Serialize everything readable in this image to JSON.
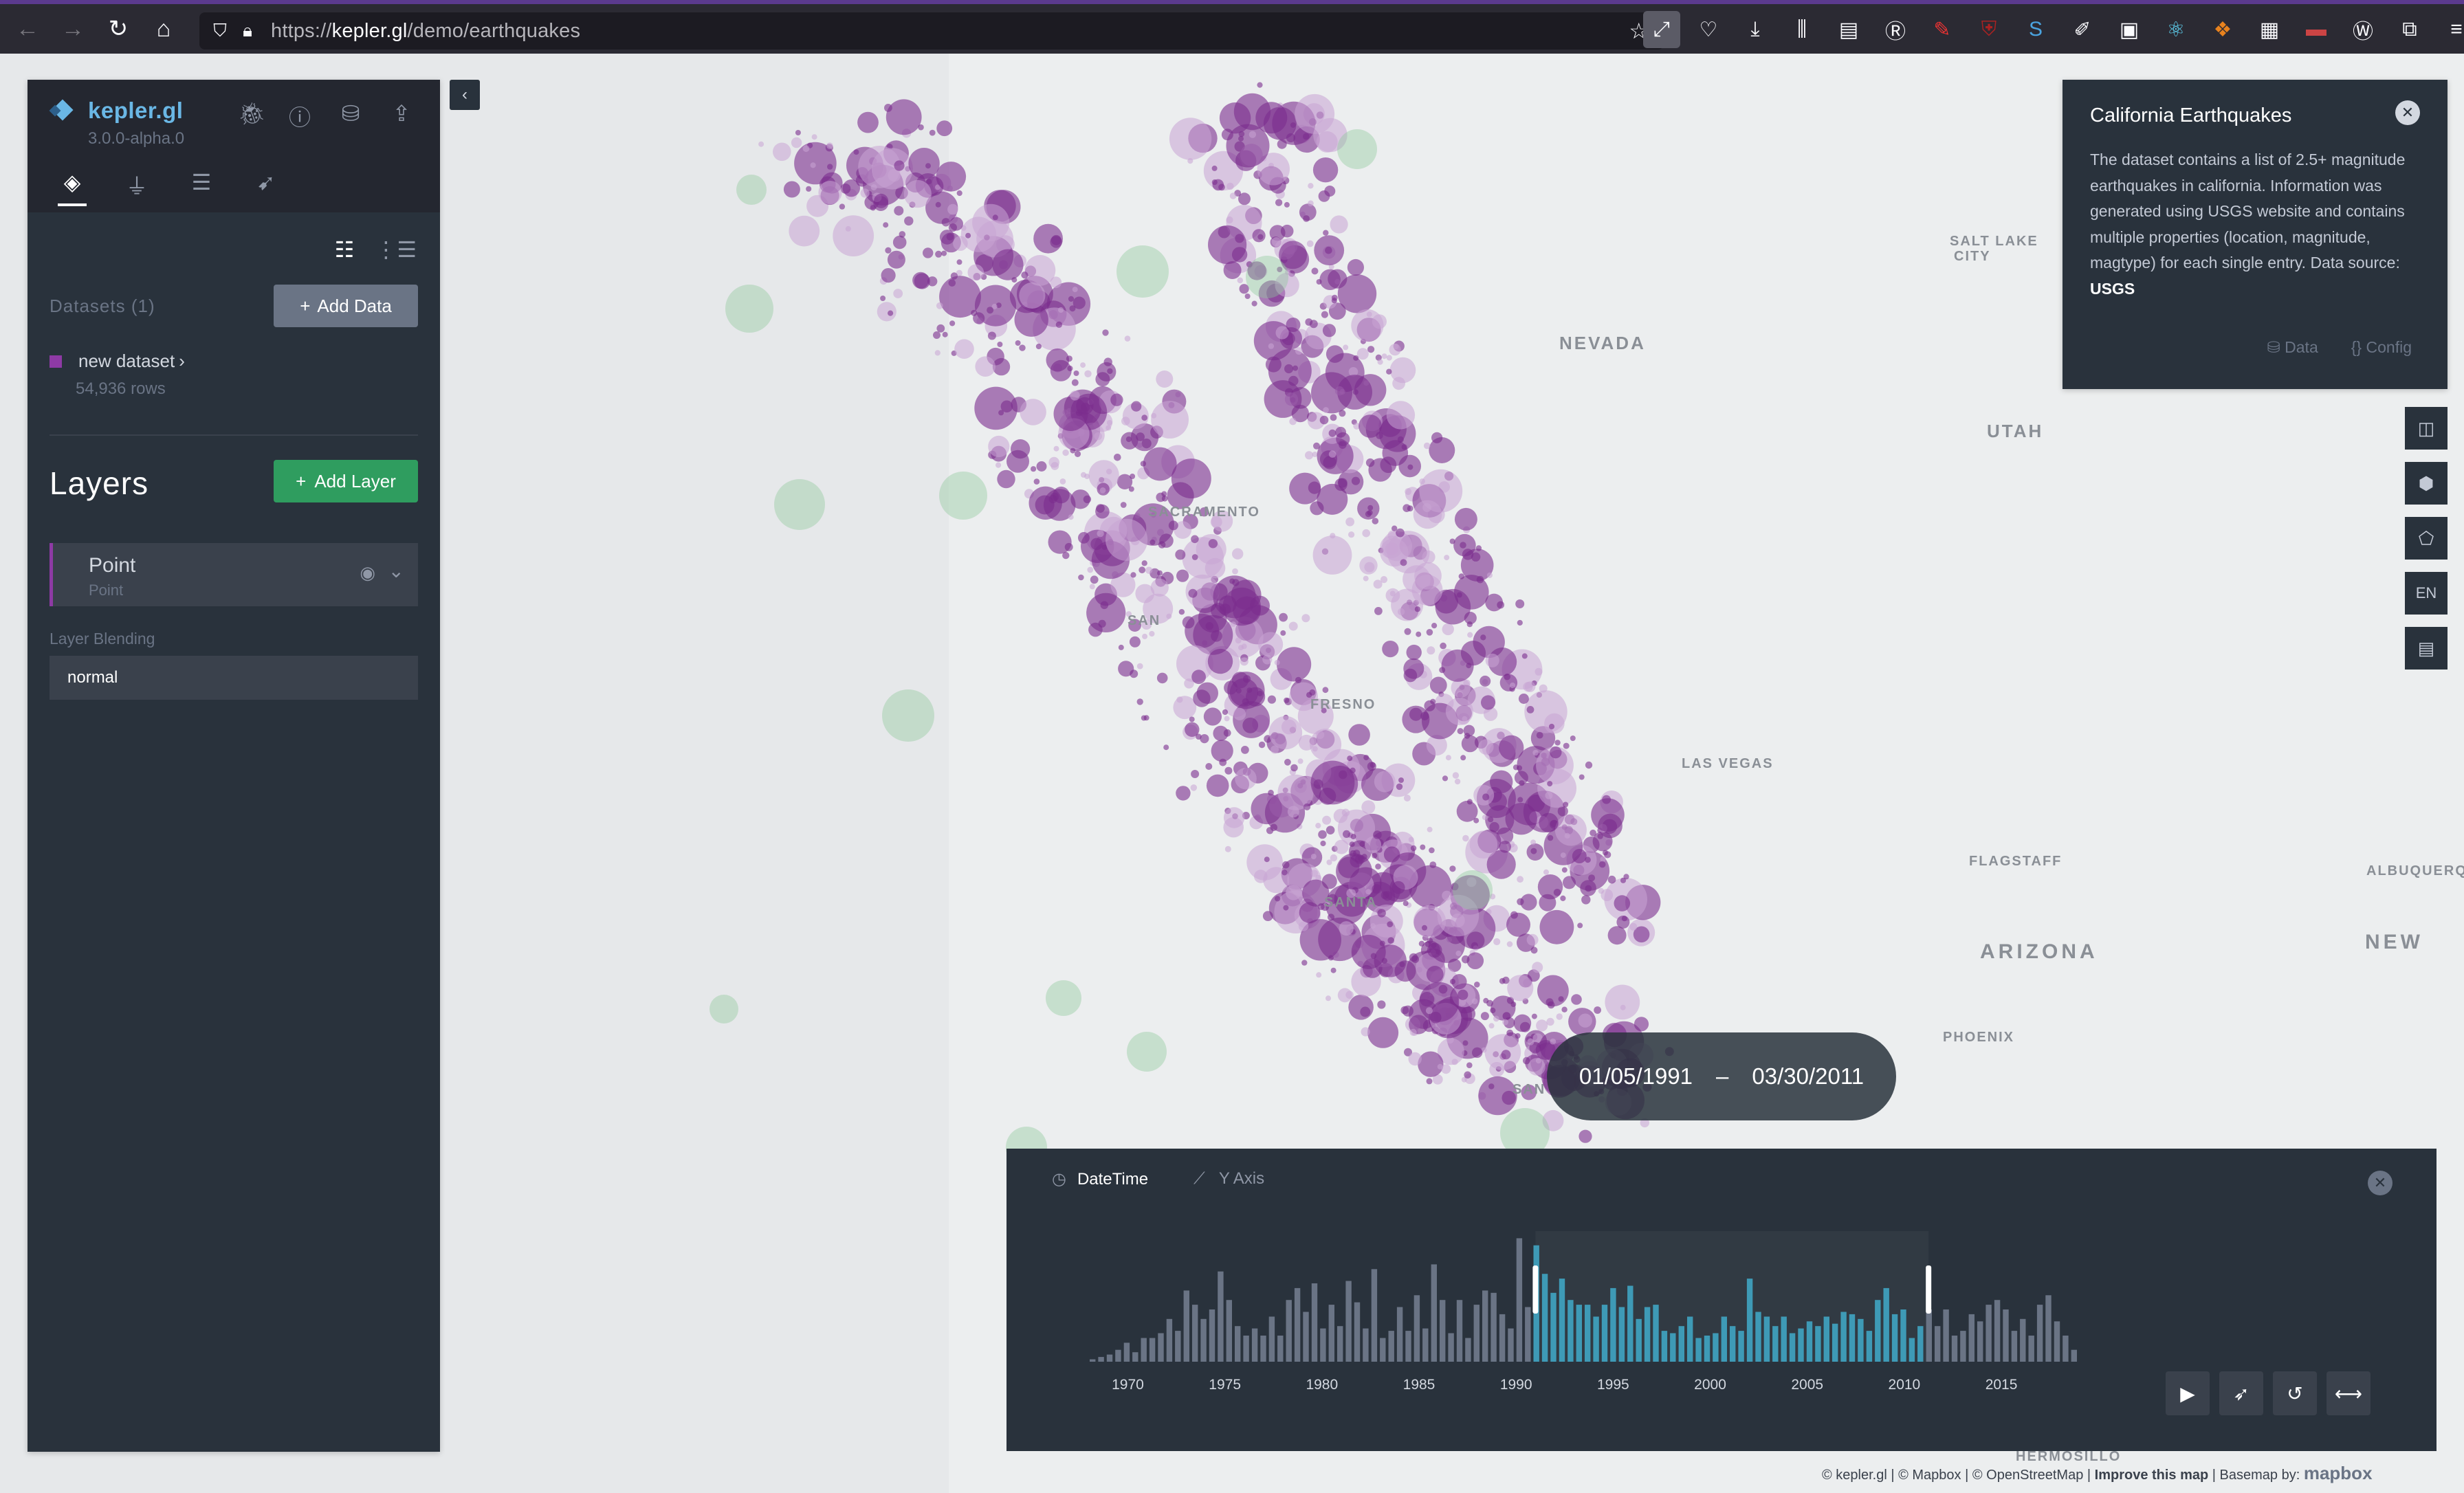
{
  "browser": {
    "url_prefix": "https://",
    "url_domain": "kepler.gl",
    "url_path": "/demo/earthquakes"
  },
  "app": {
    "name": "kepler.gl",
    "version": "3.0.0-alpha.0",
    "accent_color": "#6ab7e5"
  },
  "datasets": {
    "label": "Datasets (1)",
    "add_button": "Add Data",
    "items": [
      {
        "name": "new dataset",
        "rows": "54,936 rows",
        "color": "#8e3aa5"
      }
    ]
  },
  "layers": {
    "title": "Layers",
    "add_button": "Add Layer",
    "items": [
      {
        "name": "Point",
        "type": "Point"
      }
    ],
    "blending_label": "Layer Blending",
    "blending_value": "normal"
  },
  "info_panel": {
    "title": "California Earthquakes",
    "body": "The dataset contains a list of 2.5+ magnitude earthquakes in california. Information was generated using USGS website and contains multiple properties (location, magnitude, magtype) for each single entry. Data source: ",
    "source_link": "USGS",
    "data_tab": "Data",
    "config_tab": "Config"
  },
  "map_controls": {
    "locale": "EN"
  },
  "map_labels": [
    {
      "text": "SALT LAKE",
      "size": "small"
    },
    {
      "text": "CITY",
      "size": "small"
    },
    {
      "text": "NEVADA",
      "size": "normal"
    },
    {
      "text": "UTAH",
      "size": "normal"
    },
    {
      "text": "SACRAMENTO",
      "size": "small"
    },
    {
      "text": "FRESNO",
      "size": "small"
    },
    {
      "text": "LAS VEGAS",
      "size": "small"
    },
    {
      "text": "FLAGSTAFF",
      "size": "small"
    },
    {
      "text": "ALBUQUERQ",
      "size": "small"
    },
    {
      "text": "ARIZONA",
      "size": "large"
    },
    {
      "text": "NEW",
      "size": "large"
    },
    {
      "text": "PHOENIX",
      "size": "small"
    },
    {
      "text": "SANTA",
      "size": "small"
    },
    {
      "text": "SAN",
      "size": "small"
    },
    {
      "text": "SAN",
      "size": "small"
    },
    {
      "text": "HERMOSILLO",
      "size": "small"
    }
  ],
  "time_range": {
    "start": "01/05/1991",
    "separator": "–",
    "end": "03/30/2011"
  },
  "time_panel": {
    "field_label": "DateTime",
    "y_axis_label": "Y Axis",
    "selected_color": "#3e9ab6",
    "unselected_color": "#6a7485"
  },
  "chart_data": {
    "type": "bar",
    "x_ticks": [
      "1970",
      "1975",
      "1980",
      "1985",
      "1990",
      "1995",
      "2000",
      "2005",
      "2010",
      "2015"
    ],
    "x_range": [
      1968,
      2019
    ],
    "selected_range": [
      1991.0,
      2011.25
    ],
    "values": [
      1,
      2,
      3,
      5,
      8,
      4,
      10,
      10,
      12,
      18,
      13,
      30,
      24,
      18,
      22,
      38,
      26,
      15,
      11,
      14,
      11,
      19,
      11,
      26,
      31,
      21,
      33,
      14,
      24,
      15,
      34,
      25,
      14,
      39,
      10,
      13,
      23,
      13,
      28,
      14,
      41,
      26,
      12,
      26,
      10,
      24,
      30,
      29,
      20,
      14,
      52,
      23,
      49,
      37,
      29,
      35,
      26,
      24,
      24,
      19,
      24,
      31,
      23,
      32,
      18,
      23,
      24,
      13,
      12,
      15,
      19,
      10,
      11,
      12,
      19,
      15,
      13,
      35,
      21,
      19,
      15,
      19,
      12,
      14,
      17,
      15,
      19,
      16,
      21,
      20,
      18,
      13,
      26,
      31,
      20,
      22,
      10,
      15,
      22,
      15,
      22,
      11,
      13,
      20,
      17,
      24,
      26,
      22,
      13,
      18,
      11,
      24,
      28,
      17,
      11,
      5
    ],
    "ylim": [
      0,
      55
    ]
  },
  "attribution": {
    "text": "© kepler.gl | © Mapbox | © OpenStreetMap | ",
    "improve": "Improve this map",
    "basemap": " | Basemap by: ",
    "mapbox": "mapbox"
  }
}
